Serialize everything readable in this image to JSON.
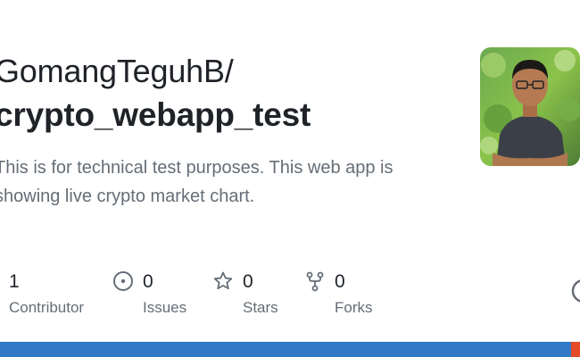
{
  "repo": {
    "owner_line": "GomangTeguhB/",
    "name_line": "crypto_webapp_test",
    "description": "This is for technical test purposes. This web app is showing live crypto market chart."
  },
  "stats": [
    {
      "icon": "contributors-icon",
      "count": "1",
      "label": "Contributor"
    },
    {
      "icon": "issue-icon",
      "count": "0",
      "label": "Issues"
    },
    {
      "icon": "star-icon",
      "count": "0",
      "label": "Stars"
    },
    {
      "icon": "fork-icon",
      "count": "0",
      "label": "Forks"
    }
  ],
  "language_bar": {
    "primary_color": "#3178c6",
    "secondary_color": "#e34c26",
    "primary_fraction": 0.985
  },
  "colors": {
    "text": "#1f2328",
    "muted": "#656d76"
  }
}
